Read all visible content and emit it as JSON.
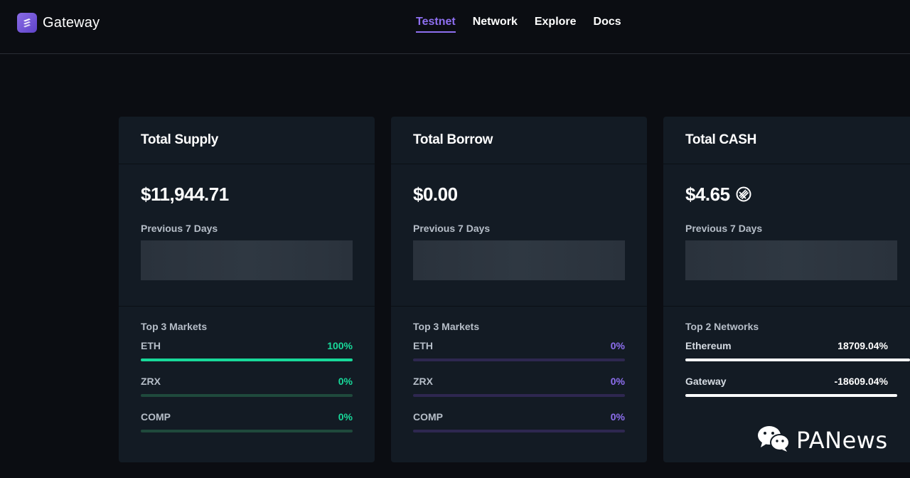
{
  "app": {
    "name": "Gateway"
  },
  "nav": {
    "items": [
      {
        "label": "Testnet",
        "active": true
      },
      {
        "label": "Network",
        "active": false
      },
      {
        "label": "Explore",
        "active": false
      },
      {
        "label": "Docs",
        "active": false
      }
    ]
  },
  "cards": [
    {
      "title": "Total Supply",
      "amount": "$11,944.71",
      "prev_label": "Previous 7 Days",
      "list_label": "Top 3 Markets",
      "accent": "#18d99a",
      "rows": [
        {
          "name": "ETH",
          "pct": "100%",
          "fill": 1.0
        },
        {
          "name": "ZRX",
          "pct": "0%",
          "fill": 0
        },
        {
          "name": "COMP",
          "pct": "0%",
          "fill": 0
        }
      ]
    },
    {
      "title": "Total Borrow",
      "amount": "$0.00",
      "prev_label": "Previous 7 Days",
      "list_label": "Top 3 Markets",
      "accent": "#8e6ff0",
      "rows": [
        {
          "name": "ETH",
          "pct": "0%",
          "fill": 0
        },
        {
          "name": "ZRX",
          "pct": "0%",
          "fill": 0
        },
        {
          "name": "COMP",
          "pct": "0%",
          "fill": 0
        }
      ]
    },
    {
      "title": "Total CASH",
      "amount": "$4.65",
      "amount_icon": "cash-token-icon",
      "prev_label": "Previous 7 Days",
      "list_label": "Top 2 Networks",
      "accent": "#ffffff",
      "rows": [
        {
          "name": "Ethereum",
          "pct": "18709.04%",
          "fill": 1.0
        },
        {
          "name": "Gateway",
          "pct": "-18609.04%",
          "fill": 1.0
        }
      ]
    }
  ],
  "watermark": {
    "text": "PANews",
    "icon": "wechat-icon"
  }
}
